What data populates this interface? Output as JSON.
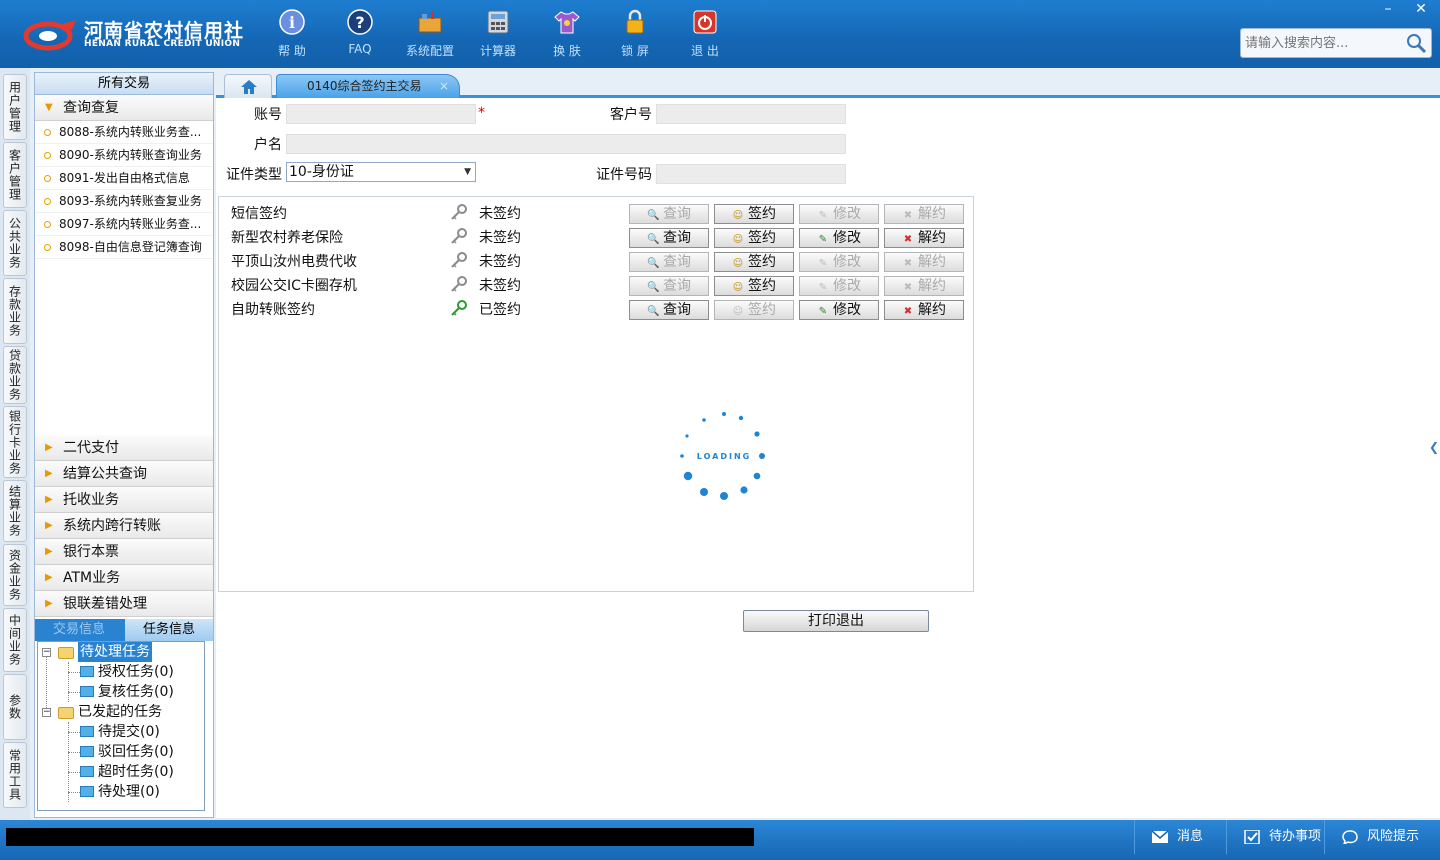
{
  "header": {
    "logo_cn": "河南省农村信用社",
    "logo_en": "HENAN RURAL CREDIT UNION",
    "toolbar": [
      {
        "label": "帮 助",
        "icon": "info-icon"
      },
      {
        "label": "FAQ",
        "icon": "question-icon"
      },
      {
        "label": "系统配置",
        "icon": "toolbox-icon"
      },
      {
        "label": "计算器",
        "icon": "calculator-icon"
      },
      {
        "label": "换 肤",
        "icon": "shirt-icon"
      },
      {
        "label": "锁 屏",
        "icon": "lock-icon"
      },
      {
        "label": "退 出",
        "icon": "power-icon"
      }
    ],
    "search_placeholder": "请输入搜索内容..."
  },
  "vtabs": [
    "用户管理",
    "客户管理",
    "公共业务",
    "存款业务",
    "贷款业务",
    "银行卡业务",
    "结算业务",
    "资金业务",
    "中间业务",
    "参数",
    "常用工具"
  ],
  "left_panel": {
    "title": "所有交易",
    "expanded_group": "查询查复",
    "items": [
      "8088-系统内转账业务查...",
      "8090-系统内转账查询业务",
      "8091-发出自由格式信息",
      "8093-系统内转账查复业务",
      "8097-系统内转账业务查...",
      "8098-自由信息登记簿查询"
    ],
    "groups": [
      "二代支付",
      "结算公共查询",
      "托收业务",
      "系统内跨行转账",
      "银行本票",
      "ATM业务",
      "银联差错处理"
    ],
    "task_tabs": [
      "交易信息",
      "任务信息"
    ],
    "tree": {
      "pending": "待处理任务",
      "auth": "授权任务(0)",
      "review": "复核任务(0)",
      "initiated": "已发起的任务",
      "to_submit": "待提交(0)",
      "rejected": "驳回任务(0)",
      "timeout": "超时任务(0)",
      "to_process": "待处理(0)"
    }
  },
  "main": {
    "tab_title": "0140综合签约主交易",
    "tab_close": "×",
    "form": {
      "account_label": "账号",
      "account_value": "",
      "required_mark": "*",
      "customer_no_label": "客户号",
      "customer_no_value": "",
      "name_label": "户名",
      "name_value": "",
      "id_type_label": "证件类型",
      "id_type_value": "10-身份证",
      "id_no_label": "证件号码",
      "id_no_value": ""
    },
    "services": [
      {
        "name": "短信签约",
        "status": "未签约",
        "signed": false,
        "query_enabled": false,
        "sign_enabled": true,
        "modify_enabled": false,
        "cancel_enabled": false
      },
      {
        "name": "新型农村养老保险",
        "status": "未签约",
        "signed": false,
        "query_enabled": true,
        "sign_enabled": true,
        "modify_enabled": true,
        "cancel_enabled": true
      },
      {
        "name": "平顶山汝州电费代收",
        "status": "未签约",
        "signed": false,
        "query_enabled": false,
        "sign_enabled": true,
        "modify_enabled": false,
        "cancel_enabled": false
      },
      {
        "name": "校园公交IC卡圈存机",
        "status": "未签约",
        "signed": false,
        "query_enabled": false,
        "sign_enabled": true,
        "modify_enabled": false,
        "cancel_enabled": false
      },
      {
        "name": "自助转账签约",
        "status": "已签约",
        "signed": true,
        "query_enabled": true,
        "sign_enabled": false,
        "modify_enabled": true,
        "cancel_enabled": true
      }
    ],
    "buttons": {
      "query": "查询",
      "sign": "签约",
      "modify": "修改",
      "cancel": "解约"
    },
    "loading_text": "LOADING",
    "print_exit": "打印退出"
  },
  "statusbar": {
    "messages": "消息",
    "todo": "待办事项",
    "risk": "风险提示"
  },
  "colors": {
    "header": "#1466b4",
    "accent": "#2a83d0",
    "required": "#dd0000"
  }
}
